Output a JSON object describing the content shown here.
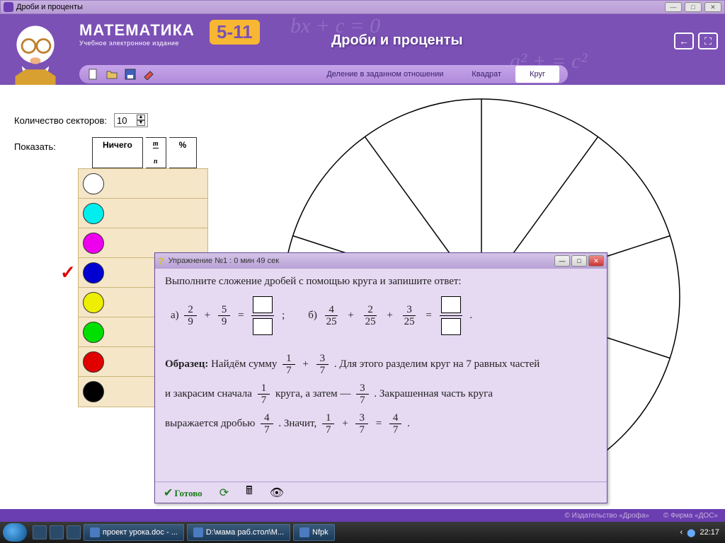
{
  "window": {
    "title": "Дроби и проценты"
  },
  "header": {
    "logo_text": "МАТЕМАТИКА",
    "logo_subtitle": "Учебное электронное издание",
    "badge": "5-11",
    "section_title": "Дроби и проценты"
  },
  "toolbar": {
    "tabs": [
      {
        "label": "Деление в заданном отношении",
        "active": false
      },
      {
        "label": "Квадрат",
        "active": false
      },
      {
        "label": "Круг",
        "active": true
      }
    ]
  },
  "controls": {
    "sector_label": "Количество секторов:",
    "sector_value": "10",
    "show_label": "Показать:",
    "show_tabs": {
      "nothing": "Ничего",
      "fraction_sym": "m/n",
      "percent": "%"
    }
  },
  "palette": {
    "colors": [
      "#ffffff",
      "#00eeee",
      "#ee00ee",
      "#0000d0",
      "#eeee00",
      "#00e000",
      "#e00000",
      "#000000"
    ],
    "checked_index": 3
  },
  "chart_data": {
    "type": "pie",
    "title": "",
    "sectors": 10,
    "values": [
      1,
      1,
      1,
      1,
      1,
      1,
      1,
      1,
      1,
      1
    ],
    "colored": [],
    "note": "Circle divided into 10 equal uncolored sectors (partially visible)"
  },
  "exercise": {
    "dialog_title": "Упражнение №1 : 0 мин  49 сек",
    "task_text": "Выполните сложение дробей с помощью круга и запишите ответ:",
    "problem_a": {
      "label": "а)",
      "f1": {
        "n": "2",
        "d": "9"
      },
      "f2": {
        "n": "5",
        "d": "9"
      },
      "sep": ";"
    },
    "problem_b": {
      "label": "б)",
      "f1": {
        "n": "4",
        "d": "25"
      },
      "f2": {
        "n": "2",
        "d": "25"
      },
      "f3": {
        "n": "3",
        "d": "25"
      },
      "end": "."
    },
    "sample": {
      "label": "Образец:",
      "t1": "Найдём сумму",
      "s1": {
        "n": "1",
        "d": "7"
      },
      "s2": {
        "n": "3",
        "d": "7"
      },
      "t2": ". Для этого разделим круг на 7 равных частей",
      "t3": "и закрасим сначала",
      "s3": {
        "n": "1",
        "d": "7"
      },
      "t4": "круга, а затем —",
      "s4": {
        "n": "3",
        "d": "7"
      },
      "t5": ". Закрашенная часть круга",
      "t6": "выражается дробью",
      "s5": {
        "n": "4",
        "d": "7"
      },
      "t7": ". Значит,",
      "s6": {
        "n": "1",
        "d": "7"
      },
      "s7": {
        "n": "3",
        "d": "7"
      },
      "s8": {
        "n": "4",
        "d": "7"
      },
      "endpunct": "."
    },
    "done_label": "Готово"
  },
  "footer": {
    "pub": "© Издательство «Дрофа»",
    "firm": "© Фирма «ДОС»"
  },
  "taskbar": {
    "items": [
      {
        "label": "проект урока.doc - ..."
      },
      {
        "label": "D:\\мама раб.стол\\М..."
      },
      {
        "label": "Nfpk"
      }
    ],
    "clock": "22:17"
  }
}
